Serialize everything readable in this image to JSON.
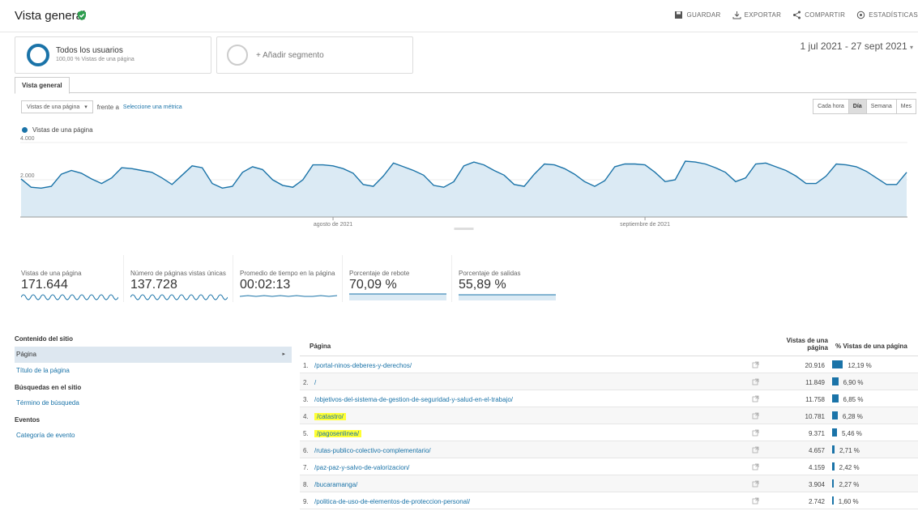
{
  "header": {
    "title": "Vista general",
    "actions": [
      "GUARDAR",
      "EXPORTAR",
      "COMPARTIR",
      "ESTADÍSTICAS"
    ]
  },
  "segments": {
    "active_title": "Todos los usuarios",
    "active_sub": "100,00 % Vistas de una página",
    "add_label": "+ Añadir segmento"
  },
  "date_range": "1 jul 2021 - 27 sept 2021",
  "tabs": [
    "Vista general"
  ],
  "metric_selector": {
    "metric": "Vistas de una página",
    "versus": "frente a",
    "select": "Seleccione una métrica"
  },
  "granularity": {
    "options": [
      "Cada hora",
      "Día",
      "Semana",
      "Mes"
    ],
    "active": "Día"
  },
  "colors": {
    "accent": "#1a73a8",
    "area_fill": "#dbeaf4",
    "highlight": "#ffff33"
  },
  "chart_data": {
    "type": "area",
    "series": [
      {
        "name": "Vistas de una página",
        "values": [
          2050,
          1600,
          1550,
          1650,
          2300,
          2500,
          2350,
          2050,
          1800,
          2100,
          2650,
          2600,
          2500,
          2400,
          2100,
          1750,
          2250,
          2750,
          2650,
          1800,
          1550,
          1650,
          2400,
          2700,
          2550,
          2000,
          1700,
          1600,
          2000,
          2800,
          2800,
          2750,
          2600,
          2350,
          1750,
          1650,
          2200,
          2900,
          2700,
          2500,
          2250,
          1700,
          1600,
          1900,
          2750,
          2950,
          2800,
          2500,
          2250,
          1750,
          1650,
          2300,
          2850,
          2800,
          2600,
          2300,
          1900,
          1650,
          1950,
          2700,
          2850,
          2850,
          2800,
          2400,
          1900,
          2000,
          3000,
          2950,
          2850,
          2650,
          2400,
          1900,
          2100,
          2850,
          2900,
          2700,
          2500,
          2200,
          1800,
          1800,
          2200,
          2850,
          2800,
          2700,
          2450,
          2100,
          1750,
          1750,
          2400
        ]
      }
    ],
    "ylim": [
      0,
      4000
    ],
    "y_ticks": [
      "4.000",
      "2.000"
    ],
    "y_tick_values": [
      4000,
      2000
    ],
    "x_labels": [
      "agosto de 2021",
      "septiembre de 2021"
    ],
    "x_label_index": [
      31,
      62
    ],
    "grid": true
  },
  "scorecards": [
    {
      "label": "Vistas de una página",
      "value": "171.644"
    },
    {
      "label": "Número de páginas vistas únicas",
      "value": "137.728"
    },
    {
      "label": "Promedio de tiempo en la página",
      "value": "00:02:13"
    },
    {
      "label": "Porcentaje de rebote",
      "value": "70,09 %"
    },
    {
      "label": "Porcentaje de salidas",
      "value": "55,89 %"
    }
  ],
  "left_nav": {
    "content_head": "Contenido del sitio",
    "page": "Página",
    "page_title": "Título de la página",
    "search_head": "Búsquedas en el sitio",
    "search_term": "Término de búsqueda",
    "events_head": "Eventos",
    "event_category": "Categoría de evento"
  },
  "table": {
    "col_page": "Página",
    "col_views": "Vistas de una página",
    "col_pct": "% Vistas de una página",
    "rows": [
      {
        "idx": "1.",
        "url": "/portal-ninos-deberes-y-derechos/",
        "views": "20.916",
        "pct": "12,19 %",
        "share": 12.19,
        "highlight": false
      },
      {
        "idx": "2.",
        "url": "/",
        "views": "11.849",
        "pct": "6,90 %",
        "share": 6.9,
        "highlight": false
      },
      {
        "idx": "3.",
        "url": "/objetivos-del-sistema-de-gestion-de-seguridad-y-salud-en-el-trabajo/",
        "views": "11.758",
        "pct": "6,85 %",
        "share": 6.85,
        "highlight": false
      },
      {
        "idx": "4.",
        "url": "/catastro/",
        "views": "10.781",
        "pct": "6,28 %",
        "share": 6.28,
        "highlight": true
      },
      {
        "idx": "5.",
        "url": "/pagosenlinea/",
        "views": "9.371",
        "pct": "5,46 %",
        "share": 5.46,
        "highlight": true
      },
      {
        "idx": "6.",
        "url": "/rutas-publico-colectivo-complementario/",
        "views": "4.657",
        "pct": "2,71 %",
        "share": 2.71,
        "highlight": false
      },
      {
        "idx": "7.",
        "url": "/paz-paz-y-salvo-de-valorizacion/",
        "views": "4.159",
        "pct": "2,42 %",
        "share": 2.42,
        "highlight": false
      },
      {
        "idx": "8.",
        "url": "/bucaramanga/",
        "views": "3.904",
        "pct": "2,27 %",
        "share": 2.27,
        "highlight": false
      },
      {
        "idx": "9.",
        "url": "/politica-de-uso-de-elementos-de-proteccion-personal/",
        "views": "2.742",
        "pct": "1,60 %",
        "share": 1.6,
        "highlight": false
      }
    ]
  }
}
